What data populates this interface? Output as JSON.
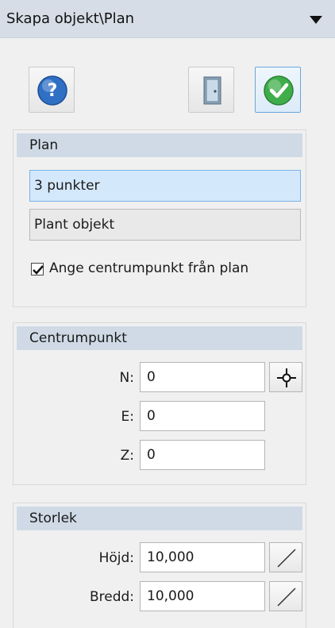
{
  "panel": {
    "title": "Skapa objekt\\Plan"
  },
  "toolbar": {
    "help_icon": "help-icon",
    "door_icon": "door-icon",
    "ok_icon": "checkmark-icon"
  },
  "plan_group": {
    "header": "Plan",
    "options": [
      "3 punkter",
      "Plant objekt"
    ],
    "selected_index": 0,
    "checkbox_label": "Ange centrumpunkt från plan",
    "checkbox_checked": true
  },
  "center_group": {
    "header": "Centrumpunkt",
    "fields": [
      {
        "label": "N:",
        "value": "0"
      },
      {
        "label": "E:",
        "value": "0"
      },
      {
        "label": "Z:",
        "value": "0"
      }
    ],
    "pick_icon": "crosshair-icon"
  },
  "size_group": {
    "header": "Storlek",
    "fields": [
      {
        "label": "Höjd:",
        "value": "10,000"
      },
      {
        "label": "Bredd:",
        "value": "10,000"
      }
    ],
    "measure_icon": "measure-line-icon"
  },
  "colors": {
    "accent": "#6aa6dc",
    "group_header": "#cfdae6",
    "selection": "#d4e8fb"
  }
}
